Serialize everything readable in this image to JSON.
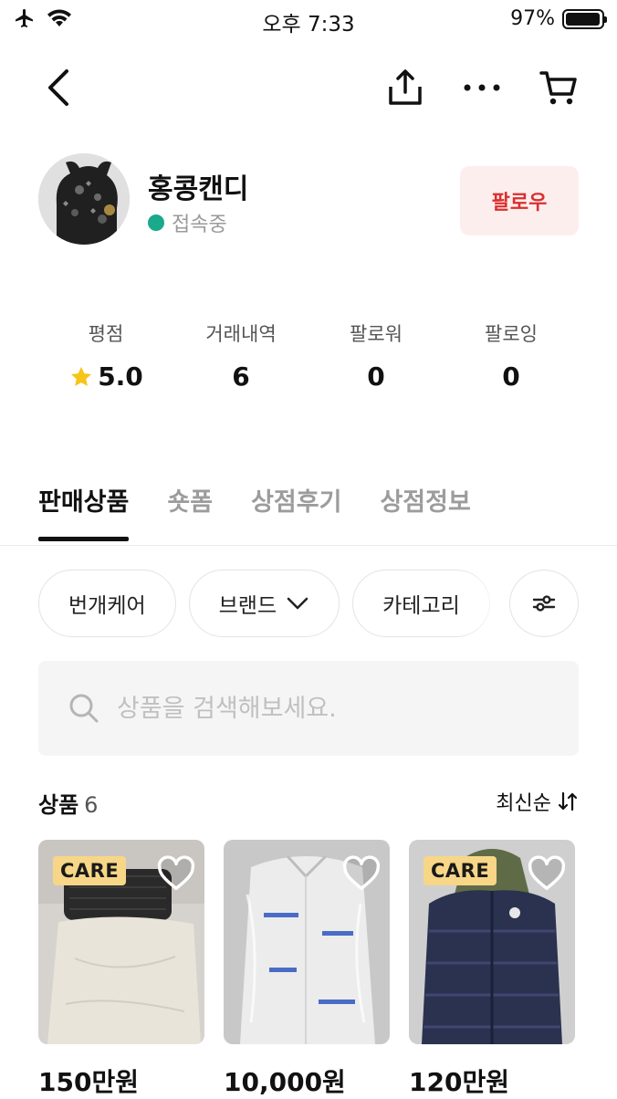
{
  "status_bar": {
    "time": "오후 7:33",
    "battery": "97%",
    "battery_level": 0.97
  },
  "nav": {
    "icons": [
      "back-icon",
      "share-icon",
      "more-icon",
      "cart-icon"
    ]
  },
  "profile": {
    "name": "홍콩캔디",
    "status": "접속중",
    "follow_label": "팔로우",
    "colors": {
      "online": "#1aa98a",
      "follow_text": "#d9302f",
      "follow_bg": "#fdeeee"
    }
  },
  "stats": [
    {
      "label": "평점",
      "value": "5.0",
      "icon": "star-icon"
    },
    {
      "label": "거래내역",
      "value": "6"
    },
    {
      "label": "팔로워",
      "value": "0"
    },
    {
      "label": "팔로잉",
      "value": "0"
    }
  ],
  "tabs": [
    {
      "label": "판매상품",
      "active": true
    },
    {
      "label": "숏폼"
    },
    {
      "label": "상점후기"
    },
    {
      "label": "상점정보"
    }
  ],
  "filters": {
    "chips": [
      "번개케어",
      "브랜드",
      "카테고리"
    ]
  },
  "search": {
    "placeholder": "상품을 검색해보세요."
  },
  "products": {
    "title": "상품",
    "count": "6",
    "sort_label": "최신순",
    "items": [
      {
        "price": "150만원",
        "badge": "CARE"
      },
      {
        "price": "10,000원",
        "badge": ""
      },
      {
        "price": "120만원",
        "badge": "CARE"
      }
    ]
  }
}
